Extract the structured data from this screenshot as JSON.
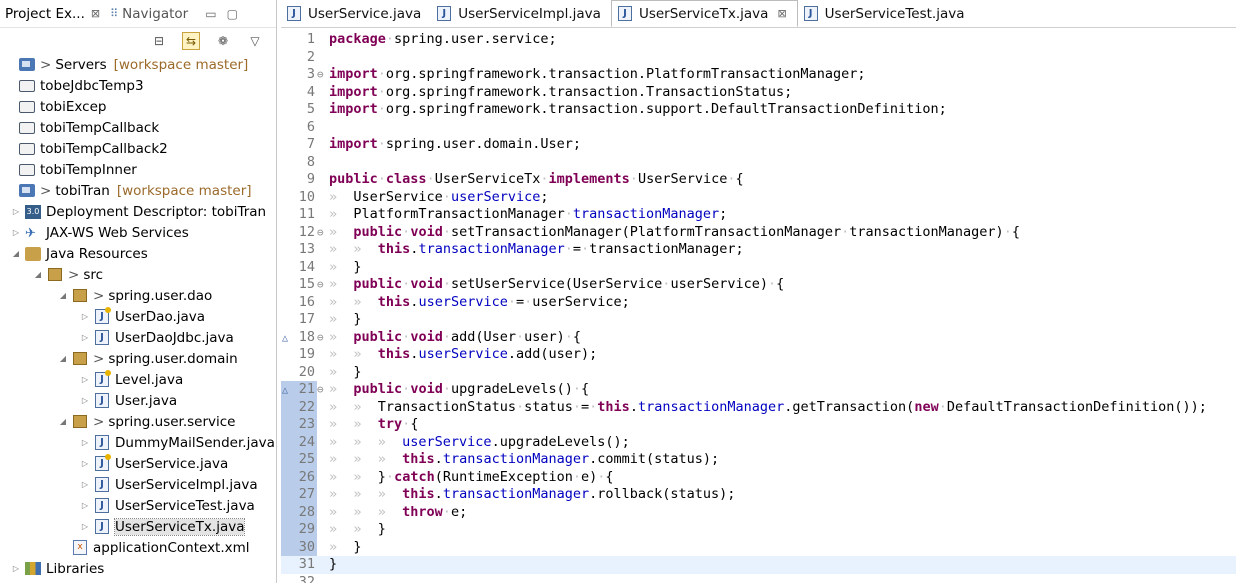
{
  "left": {
    "tabs": [
      {
        "label": "Project Ex...",
        "close": "⊠"
      },
      {
        "label": "Navigator"
      }
    ],
    "controls": {
      "minimize": "▭",
      "maximize": "▢"
    },
    "tree": [
      {
        "indent": 0,
        "twist": "",
        "icon": "project",
        "label": "Servers",
        "prefix": ">",
        "decor": "[workspace master]"
      },
      {
        "indent": 0,
        "twist": "",
        "icon": "folder",
        "label": "tobeJdbcTemp3"
      },
      {
        "indent": 0,
        "twist": "",
        "icon": "folder",
        "label": "tobiExcep"
      },
      {
        "indent": 0,
        "twist": "",
        "icon": "folder",
        "label": "tobiTempCallback"
      },
      {
        "indent": 0,
        "twist": "",
        "icon": "folder",
        "label": "tobiTempCallback2"
      },
      {
        "indent": 0,
        "twist": "",
        "icon": "folder",
        "label": "tobiTempInner"
      },
      {
        "indent": 0,
        "twist": "",
        "icon": "project",
        "label": "tobiTran",
        "prefix": ">",
        "decor": "[workspace master]"
      },
      {
        "indent": 1,
        "twist": "▷",
        "icon": "dd",
        "label": "Deployment Descriptor: tobiTran"
      },
      {
        "indent": 1,
        "twist": "▷",
        "icon": "ws",
        "label": "JAX-WS Web Services"
      },
      {
        "indent": 1,
        "twist": "◢",
        "icon": "jres",
        "label": "Java Resources"
      },
      {
        "indent": 2,
        "twist": "◢",
        "icon": "pkg",
        "label": "src",
        "prefix": ">"
      },
      {
        "indent": 3,
        "twist": "◢",
        "icon": "pkg",
        "label": "spring.user.dao",
        "prefix": ">"
      },
      {
        "indent": 4,
        "twist": "▷",
        "icon": "java-w",
        "label": "UserDao.java"
      },
      {
        "indent": 4,
        "twist": "▷",
        "icon": "java",
        "label": "UserDaoJdbc.java"
      },
      {
        "indent": 3,
        "twist": "◢",
        "icon": "pkg",
        "label": "spring.user.domain",
        "prefix": ">"
      },
      {
        "indent": 4,
        "twist": "▷",
        "icon": "java-w",
        "label": "Level.java"
      },
      {
        "indent": 4,
        "twist": "▷",
        "icon": "java",
        "label": "User.java"
      },
      {
        "indent": 3,
        "twist": "◢",
        "icon": "pkg",
        "label": "spring.user.service",
        "prefix": ">"
      },
      {
        "indent": 4,
        "twist": "▷",
        "icon": "java",
        "label": "DummyMailSender.java"
      },
      {
        "indent": 4,
        "twist": "▷",
        "icon": "java-w",
        "label": "UserService.java"
      },
      {
        "indent": 4,
        "twist": "▷",
        "icon": "java",
        "label": "UserServiceImpl.java"
      },
      {
        "indent": 4,
        "twist": "▷",
        "icon": "java",
        "label": "UserServiceTest.java"
      },
      {
        "indent": 4,
        "twist": "▷",
        "icon": "java",
        "label": "UserServiceTx.java",
        "selected": true
      },
      {
        "indent": 3,
        "twist": "",
        "icon": "xml",
        "label": "applicationContext.xml"
      },
      {
        "indent": 1,
        "twist": "▷",
        "icon": "lib",
        "label": "Libraries"
      }
    ]
  },
  "editor": {
    "tabs": [
      {
        "label": "UserService.java",
        "active": false
      },
      {
        "label": "UserServiceImpl.java",
        "active": false
      },
      {
        "label": "UserServiceTx.java",
        "active": true,
        "close": "⊠"
      },
      {
        "label": "UserServiceTest.java",
        "active": false
      }
    ],
    "lines": [
      {
        "n": "1",
        "fold": "",
        "segs": [
          [
            "kw",
            "package"
          ],
          [
            "ws",
            "·"
          ],
          [
            "t",
            "spring.user.service;"
          ]
        ]
      },
      {
        "n": "2",
        "fold": "",
        "segs": []
      },
      {
        "n": "3",
        "fold": "⊖",
        "segs": [
          [
            "kw",
            "import"
          ],
          [
            "ws",
            "·"
          ],
          [
            "t",
            "org.springframework.transaction.PlatformTransactionManager;"
          ]
        ]
      },
      {
        "n": "4",
        "fold": "",
        "segs": [
          [
            "kw",
            "import"
          ],
          [
            "ws",
            "·"
          ],
          [
            "t",
            "org.springframework.transaction.TransactionStatus;"
          ]
        ]
      },
      {
        "n": "5",
        "fold": "",
        "segs": [
          [
            "kw",
            "import"
          ],
          [
            "ws",
            "·"
          ],
          [
            "t",
            "org.springframework.transaction.support.DefaultTransactionDefinition;"
          ]
        ]
      },
      {
        "n": "6",
        "fold": "",
        "segs": []
      },
      {
        "n": "7",
        "fold": "",
        "segs": [
          [
            "kw",
            "import"
          ],
          [
            "ws",
            "·"
          ],
          [
            "t",
            "spring.user.domain.User;"
          ]
        ]
      },
      {
        "n": "8",
        "fold": "",
        "segs": []
      },
      {
        "n": "9",
        "fold": "",
        "segs": [
          [
            "kw",
            "public"
          ],
          [
            "ws",
            "·"
          ],
          [
            "kw",
            "class"
          ],
          [
            "ws",
            "·"
          ],
          [
            "t",
            "UserServiceTx"
          ],
          [
            "ws",
            "·"
          ],
          [
            "kw",
            "implements"
          ],
          [
            "ws",
            "·"
          ],
          [
            "t",
            "UserService"
          ],
          [
            "ws",
            "·"
          ],
          [
            "t",
            "{"
          ]
        ]
      },
      {
        "n": "10",
        "fold": "",
        "segs": [
          [
            "ws",
            "»  "
          ],
          [
            "t",
            "UserService"
          ],
          [
            "ws",
            "·"
          ],
          [
            "fld",
            "userService"
          ],
          [
            "t",
            ";"
          ]
        ]
      },
      {
        "n": "11",
        "fold": "",
        "segs": [
          [
            "ws",
            "»  "
          ],
          [
            "t",
            "PlatformTransactionManager"
          ],
          [
            "ws",
            "·"
          ],
          [
            "fld",
            "transactionManager"
          ],
          [
            "t",
            ";"
          ]
        ]
      },
      {
        "n": "12",
        "fold": "⊖",
        "segs": [
          [
            "ws",
            "»  "
          ],
          [
            "kw",
            "public"
          ],
          [
            "ws",
            "·"
          ],
          [
            "kw",
            "void"
          ],
          [
            "ws",
            "·"
          ],
          [
            "t",
            "setTransactionManager(PlatformTransactionManager"
          ],
          [
            "ws",
            "·"
          ],
          [
            "t",
            "transactionManager)"
          ],
          [
            "ws",
            "·"
          ],
          [
            "t",
            "{"
          ]
        ]
      },
      {
        "n": "13",
        "fold": "",
        "segs": [
          [
            "ws",
            "»  »  "
          ],
          [
            "kw",
            "this"
          ],
          [
            "t",
            "."
          ],
          [
            "fld",
            "transactionManager"
          ],
          [
            "ws",
            "·"
          ],
          [
            "t",
            "="
          ],
          [
            "ws",
            "·"
          ],
          [
            "t",
            "transactionManager;"
          ]
        ]
      },
      {
        "n": "14",
        "fold": "",
        "segs": [
          [
            "ws",
            "»  "
          ],
          [
            "t",
            "}"
          ]
        ]
      },
      {
        "n": "15",
        "fold": "⊖",
        "segs": [
          [
            "ws",
            "»  "
          ],
          [
            "kw",
            "public"
          ],
          [
            "ws",
            "·"
          ],
          [
            "kw",
            "void"
          ],
          [
            "ws",
            "·"
          ],
          [
            "t",
            "setUserService(UserService"
          ],
          [
            "ws",
            "·"
          ],
          [
            "t",
            "userService)"
          ],
          [
            "ws",
            "·"
          ],
          [
            "t",
            "{"
          ]
        ]
      },
      {
        "n": "16",
        "fold": "",
        "segs": [
          [
            "ws",
            "»  »  "
          ],
          [
            "kw",
            "this"
          ],
          [
            "t",
            "."
          ],
          [
            "fld",
            "userService"
          ],
          [
            "ws",
            "·"
          ],
          [
            "t",
            "="
          ],
          [
            "ws",
            "·"
          ],
          [
            "t",
            "userService;"
          ]
        ]
      },
      {
        "n": "17",
        "fold": "",
        "segs": [
          [
            "ws",
            "»  "
          ],
          [
            "t",
            "}"
          ]
        ]
      },
      {
        "n": "18",
        "fold": "⊖",
        "mark": "△",
        "segs": [
          [
            "ws",
            "»  "
          ],
          [
            "kw",
            "public"
          ],
          [
            "ws",
            "·"
          ],
          [
            "kw",
            "void"
          ],
          [
            "ws",
            "·"
          ],
          [
            "t",
            "add(User"
          ],
          [
            "ws",
            "·"
          ],
          [
            "t",
            "user)"
          ],
          [
            "ws",
            "·"
          ],
          [
            "t",
            "{"
          ]
        ]
      },
      {
        "n": "19",
        "fold": "",
        "segs": [
          [
            "ws",
            "»  »  "
          ],
          [
            "kw",
            "this"
          ],
          [
            "t",
            "."
          ],
          [
            "fld",
            "userService"
          ],
          [
            "t",
            ".add(user);"
          ]
        ]
      },
      {
        "n": "20",
        "fold": "",
        "segs": [
          [
            "ws",
            "»  "
          ],
          [
            "t",
            "}"
          ]
        ]
      },
      {
        "n": "21",
        "fold": "⊖",
        "mark": "△",
        "ov": true,
        "segs": [
          [
            "ws",
            "»  "
          ],
          [
            "kw",
            "public"
          ],
          [
            "ws",
            "·"
          ],
          [
            "kw",
            "void"
          ],
          [
            "ws",
            "·"
          ],
          [
            "t",
            "upgradeLevels()"
          ],
          [
            "ws",
            "·"
          ],
          [
            "t",
            "{"
          ]
        ]
      },
      {
        "n": "22",
        "fold": "",
        "ov": true,
        "segs": [
          [
            "ws",
            "»  »  "
          ],
          [
            "t",
            "TransactionStatus"
          ],
          [
            "ws",
            "·"
          ],
          [
            "t",
            "status"
          ],
          [
            "ws",
            "·"
          ],
          [
            "t",
            "="
          ],
          [
            "ws",
            "·"
          ],
          [
            "kw",
            "this"
          ],
          [
            "t",
            "."
          ],
          [
            "fld",
            "transactionManager"
          ],
          [
            "t",
            ".getTransaction("
          ],
          [
            "kw",
            "new"
          ],
          [
            "ws",
            "·"
          ],
          [
            "t",
            "DefaultTransactionDefinition());"
          ]
        ]
      },
      {
        "n": "23",
        "fold": "",
        "ov": true,
        "segs": [
          [
            "ws",
            "»  »  "
          ],
          [
            "kw",
            "try"
          ],
          [
            "ws",
            "·"
          ],
          [
            "t",
            "{"
          ]
        ]
      },
      {
        "n": "24",
        "fold": "",
        "ov": true,
        "segs": [
          [
            "ws",
            "»  »  »  "
          ],
          [
            "fld",
            "userService"
          ],
          [
            "t",
            ".upgradeLevels();"
          ]
        ]
      },
      {
        "n": "25",
        "fold": "",
        "ov": true,
        "segs": [
          [
            "ws",
            "»  »  »  "
          ],
          [
            "kw",
            "this"
          ],
          [
            "t",
            "."
          ],
          [
            "fld",
            "transactionManager"
          ],
          [
            "t",
            ".commit(status);"
          ]
        ]
      },
      {
        "n": "26",
        "fold": "",
        "ov": true,
        "segs": [
          [
            "ws",
            "»  »  "
          ],
          [
            "t",
            "}"
          ],
          [
            "ws",
            "·"
          ],
          [
            "kw",
            "catch"
          ],
          [
            "t",
            "(RuntimeException"
          ],
          [
            "ws",
            "·"
          ],
          [
            "t",
            "e)"
          ],
          [
            "ws",
            "·"
          ],
          [
            "t",
            "{"
          ]
        ]
      },
      {
        "n": "27",
        "fold": "",
        "ov": true,
        "segs": [
          [
            "ws",
            "»  »  »  "
          ],
          [
            "kw",
            "this"
          ],
          [
            "t",
            "."
          ],
          [
            "fld",
            "transactionManager"
          ],
          [
            "t",
            ".rollback(status);"
          ]
        ]
      },
      {
        "n": "28",
        "fold": "",
        "ov": true,
        "segs": [
          [
            "ws",
            "»  »  »  "
          ],
          [
            "kw",
            "throw"
          ],
          [
            "ws",
            "·"
          ],
          [
            "t",
            "e;"
          ]
        ]
      },
      {
        "n": "29",
        "fold": "",
        "ov": true,
        "segs": [
          [
            "ws",
            "»  »  "
          ],
          [
            "t",
            "}"
          ]
        ]
      },
      {
        "n": "30",
        "fold": "",
        "ov": true,
        "segs": [
          [
            "ws",
            "»  "
          ],
          [
            "t",
            "}"
          ]
        ]
      },
      {
        "n": "31",
        "fold": "",
        "current": true,
        "segs": [
          [
            "t",
            "}"
          ]
        ]
      },
      {
        "n": "32",
        "fold": "",
        "segs": []
      }
    ]
  }
}
